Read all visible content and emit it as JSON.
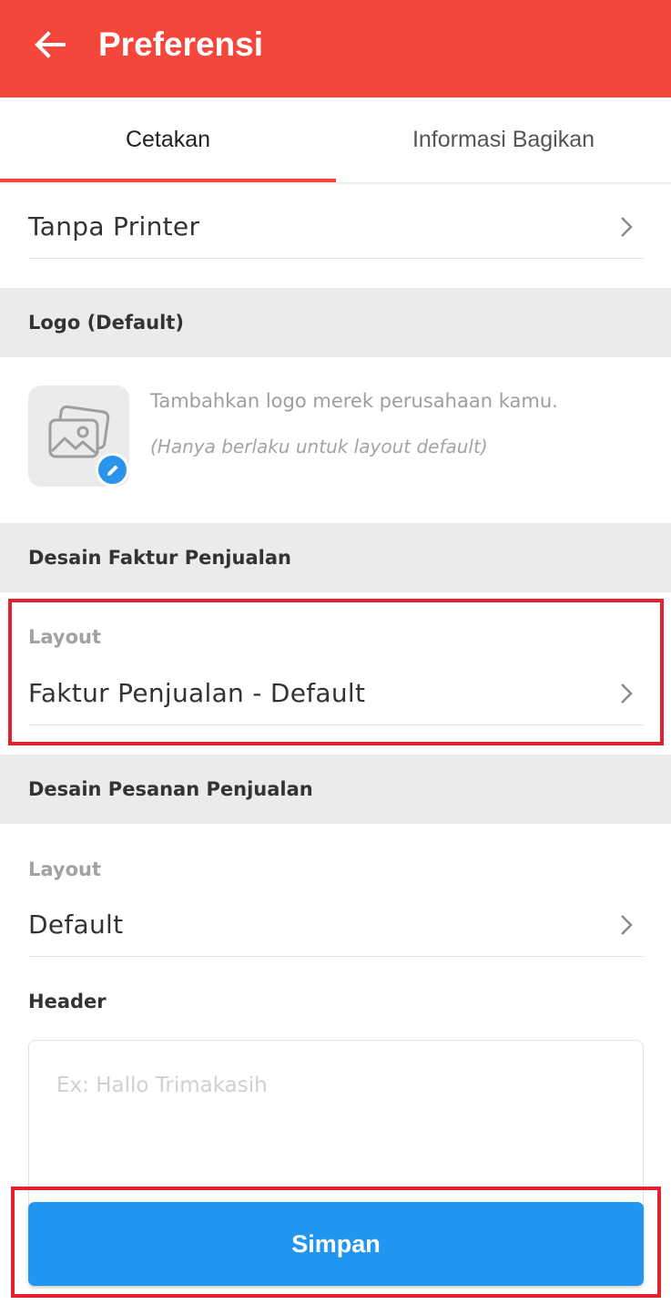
{
  "app_bar": {
    "title": "Preferensi",
    "back_icon": "arrow-left-icon",
    "color": "#f4463b"
  },
  "tabs": [
    {
      "label": "Cetakan",
      "active": true
    },
    {
      "label": "Informasi Bagikan",
      "active": false
    }
  ],
  "printer": {
    "value": "Tanpa Printer"
  },
  "logo_section": {
    "title": "Logo (Default)",
    "description": "Tambahkan logo merek perusahaan kamu.",
    "note": "(Hanya berlaku untuk layout default)",
    "placeholder_icon": "image-icon",
    "edit_icon": "pencil-icon"
  },
  "invoice_design": {
    "title": "Desain Faktur Penjualan",
    "layout_label": "Layout",
    "layout_value": "Faktur Penjualan - Default"
  },
  "order_design": {
    "title": "Desain Pesanan Penjualan",
    "layout_label": "Layout",
    "layout_value": "Default",
    "header_label": "Header",
    "header_placeholder": "Ex: Hallo Trimakasih"
  },
  "save_button": {
    "label": "Simpan",
    "color": "#2196f0"
  },
  "highlight_color": "#e5202f"
}
